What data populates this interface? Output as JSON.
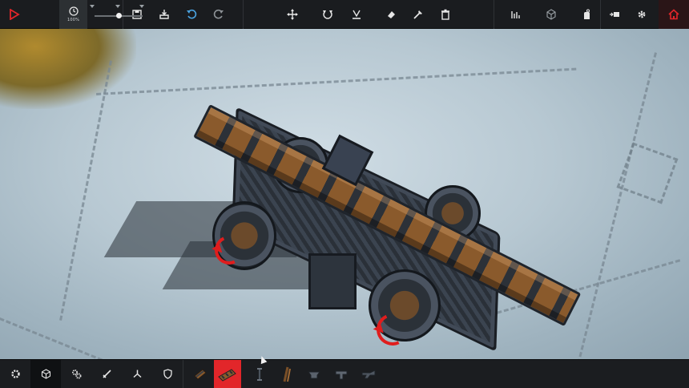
{
  "colors": {
    "accent": "#e2262a",
    "bar_bg": "#1a1c1f",
    "icon": "#e6e6e6",
    "ground": "#c4d3dc"
  },
  "top_bar": {
    "simulate": {
      "icon": "play-icon"
    },
    "time_scale": {
      "icon": "clock-icon",
      "percent_label": "100%",
      "slider_value_percent": 100
    },
    "file": [
      {
        "icon": "save-icon"
      },
      {
        "icon": "load-icon"
      }
    ],
    "history": [
      {
        "icon": "undo-icon"
      },
      {
        "icon": "redo-icon"
      }
    ],
    "tools": [
      {
        "icon": "translate-icon"
      },
      {
        "icon": "rotate-icon"
      },
      {
        "icon": "flip-icon"
      },
      {
        "icon": "eraser-icon"
      },
      {
        "icon": "pin-icon"
      },
      {
        "icon": "trash-icon"
      }
    ],
    "right": [
      {
        "icon": "stats-icon"
      },
      {
        "icon": "cube-view-icon"
      },
      {
        "icon": "hand-icon"
      },
      {
        "icon": "camera-icon"
      },
      {
        "icon": "settings-icon"
      },
      {
        "icon": "home-icon"
      }
    ]
  },
  "bottom_bar": {
    "categories": [
      {
        "icon": "starting-block-icon",
        "active": false
      },
      {
        "icon": "basic-blocks-icon",
        "active": true
      },
      {
        "icon": "mechanical-icon",
        "active": false
      },
      {
        "icon": "weapons-icon",
        "active": false
      },
      {
        "icon": "flight-icon",
        "active": false
      },
      {
        "icon": "armour-icon",
        "active": false
      }
    ],
    "blocks": [
      {
        "icon": "wooden-block-icon",
        "selected": false
      },
      {
        "icon": "log-block-icon",
        "selected": true
      },
      {
        "icon": "brace-icon",
        "selected": false
      },
      {
        "icon": "pole-icon",
        "selected": false
      },
      {
        "icon": "ballast-icon",
        "selected": false
      },
      {
        "icon": "hinge-icon",
        "selected": false
      },
      {
        "icon": "decoupler-icon",
        "selected": false
      }
    ]
  }
}
